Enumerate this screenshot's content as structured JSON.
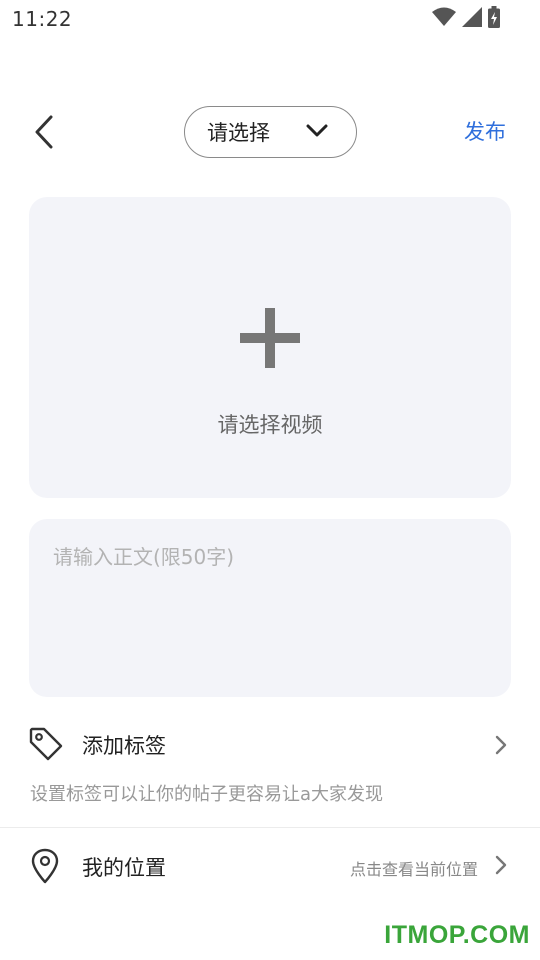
{
  "status_bar": {
    "time": "11:22",
    "icons": [
      "wifi-icon",
      "signal-icon",
      "battery-charging-icon"
    ]
  },
  "header": {
    "back_icon": "chevron-left-icon",
    "selector_label": "请选择",
    "selector_icon": "chevron-down-icon",
    "publish_label": "发布"
  },
  "video_picker": {
    "icon": "plus-icon",
    "label": "请选择视频"
  },
  "body_input": {
    "value": "",
    "placeholder": "请输入正文(限50字)"
  },
  "tag_row": {
    "icon": "tag-icon",
    "label": "添加标签",
    "hint": "设置标签可以让你的帖子更容易让a大家发现"
  },
  "location_row": {
    "icon": "location-pin-icon",
    "label": "我的位置",
    "hint": "点击查看当前位置"
  },
  "watermark": "ITMOP.COM",
  "colors": {
    "accent": "#2f6fdc",
    "card_bg": "#f3f4f9",
    "watermark": "#3aa53a"
  }
}
